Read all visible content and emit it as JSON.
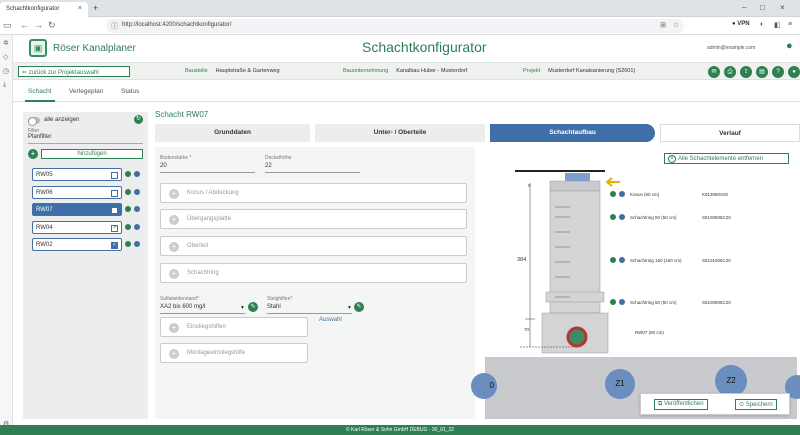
{
  "browser": {
    "tab_title": "Schachtkonfigurator",
    "url": "http://localhost:4200/schachtkonfigurator/",
    "vpn": "VPN"
  },
  "app": {
    "name": "Röser Kanalplaner",
    "page_title": "Schachtkonfigurator",
    "user_email": "admin@example.com"
  },
  "infobar": {
    "back_label": "zurück zur Projektauswahl",
    "baustelle_key": "Baustelle",
    "baustelle_val": "Hauptstraße & Gartenweg",
    "bauunternehmung_key": "Bauunternehmung",
    "bauunternehmung_val": "Kanalbau Huber - Musterdorf",
    "projekt_key": "Projekt",
    "projekt_val": "Musterdorf Kanalsanierung (S2601)"
  },
  "tabs": [
    "Schacht",
    "Verlegeplan",
    "Status"
  ],
  "left": {
    "show_all": "alle anzeigen",
    "filter_label": "Filter",
    "filter_value": "Planfilter",
    "add_label": "hinzufügen",
    "items": [
      {
        "name": "RW05",
        "state": ""
      },
      {
        "name": "RW06",
        "state": ""
      },
      {
        "name": "RW07",
        "state": "selected"
      },
      {
        "name": "RW04",
        "state": "edited"
      },
      {
        "name": "RW02",
        "state": "checked"
      }
    ]
  },
  "main": {
    "title": "Schacht RW07",
    "steps": [
      "Grunddaten",
      "Unter- / Oberteile",
      "Schachtaufbau",
      "Verlauf"
    ],
    "bodenstaerke_label": "Bodenstärke *",
    "bodenstaerke_value": "20",
    "deckelhoehe_label": "Deckelhöhe",
    "deckelhoehe_value": "22",
    "cards": [
      "Konus / Abdeckung",
      "Übergangsplatte",
      "Oberteil",
      "Schachtring"
    ],
    "sulfat_label": "Sulfatwiderstand*",
    "sulfat_value": "XA2 bis 600 mg/l",
    "steig_label": "Steighilfen*",
    "steig_value": "Stahl",
    "auswahl": "Auswahl",
    "extra_cards": [
      "Einstiegshilfen",
      "Montageeinstiegshilfe"
    ]
  },
  "viz": {
    "remove_all": "Alle Schachtelemente entfernen",
    "dim_total": "384",
    "dim_bottom": "70",
    "dim_top": "0",
    "elements": [
      {
        "name": "Konus (60 cm)",
        "code": "K013060S20"
      },
      {
        "name": "Schachtring 50 (50 cm)",
        "code": "S5100505C20"
      },
      {
        "name": "Schachtring 150 (150 cm)",
        "code": "S5101505C20"
      },
      {
        "name": "Schachtring 50 (50 cm)",
        "code": "S5100505C20"
      },
      {
        "name": "RW07 (90 cm)",
        "code": ""
      }
    ],
    "circles": [
      "Z1",
      "Z2",
      "0"
    ]
  },
  "actions": {
    "publish": "Veröffentlichen",
    "save": "Speichern"
  },
  "footer": "© Karl Röser & Sohn GmbH    DEBUG - 30_01_22"
}
